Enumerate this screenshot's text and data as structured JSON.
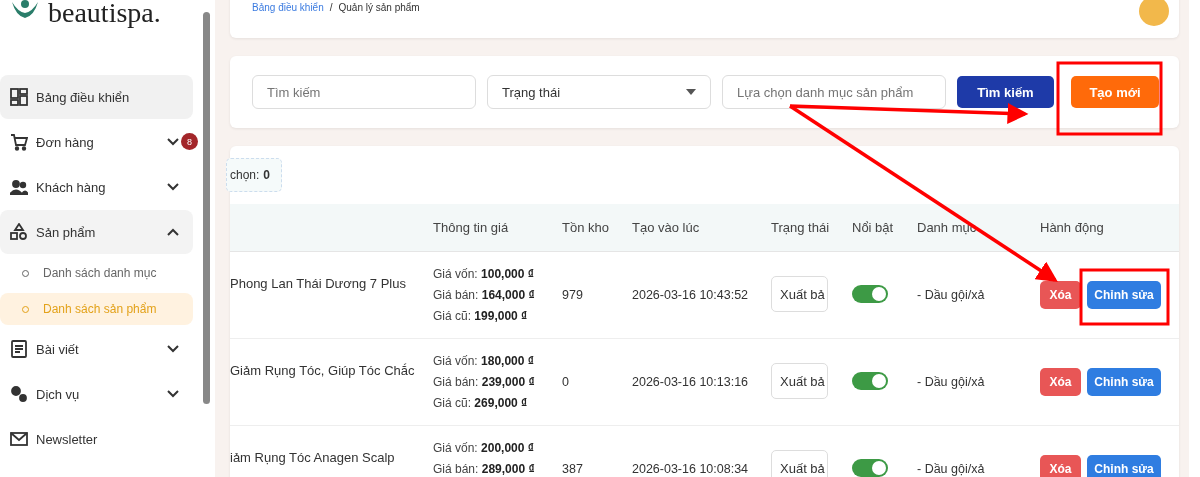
{
  "logo": {
    "text": "beautispa."
  },
  "breadcrumb": [
    {
      "label": "Bảng điều khiển",
      "link": true
    },
    {
      "label": "/",
      "link": false
    },
    {
      "label": "Quản lý sản phẩm",
      "link": false
    }
  ],
  "sidebar": {
    "items": [
      {
        "label": "Bảng điều khiển",
        "selected": false,
        "hovered": true
      },
      {
        "label": "Đơn hàng",
        "expanded": false,
        "badge": "8",
        "selected": false
      },
      {
        "label": "Khách hàng",
        "expanded": false,
        "selected": false
      },
      {
        "label": "Sản phẩm",
        "expanded": true,
        "selected": false,
        "children": [
          {
            "label": "Danh sách danh mục",
            "selected": false
          },
          {
            "label": "Danh sách sản phẩm",
            "selected": true
          }
        ]
      },
      {
        "label": "Bài viết",
        "expanded": false,
        "selected": false
      },
      {
        "label": "Dịch vụ",
        "expanded": false,
        "selected": false
      },
      {
        "label": "Newsletter",
        "selected": false
      }
    ]
  },
  "filters": {
    "search": {
      "placeholder": "Tìm kiếm"
    },
    "status": {
      "value": "Trạng thái"
    },
    "category": {
      "placeholder": "Lựa chọn danh mục sản phẩm"
    },
    "search_button": "Tìm kiếm",
    "create_button": "Tạo mới"
  },
  "selection": {
    "label": "chọn:",
    "count": "0"
  },
  "table": {
    "columns": [
      "Thông tin giá",
      "Tồn kho",
      "Tạo vào lúc",
      "Trạng thái",
      "Nổi bật",
      "Danh mục",
      "Hành động"
    ],
    "rows": [
      {
        "name": "Phong Lan Thái Dương 7 Plus",
        "prices": [
          {
            "label": "Giá vốn:",
            "value": "100,000 ₫"
          },
          {
            "label": "Giá bán:",
            "value": "164,000 ₫"
          },
          {
            "label": "Giá cũ:",
            "value": "199,000 ₫"
          }
        ],
        "stock": "979",
        "created": "2026-03-16 10:43:52",
        "status": "Xuất bả",
        "featured": true,
        "category": "- Dầu gội/xả",
        "delete": "Xóa",
        "edit": "Chỉnh sửa"
      },
      {
        "name": "Giảm Rụng Tóc, Giúp Tóc Chắc",
        "prices": [
          {
            "label": "Giá vốn:",
            "value": "180,000 ₫"
          },
          {
            "label": "Giá bán:",
            "value": "239,000 ₫"
          },
          {
            "label": "Giá cũ:",
            "value": "269,000 ₫"
          }
        ],
        "stock": "0",
        "created": "2026-03-16 10:13:16",
        "status": "Xuất bả",
        "featured": true,
        "category": "- Dầu gội/xả",
        "delete": "Xóa",
        "edit": "Chỉnh sửa"
      },
      {
        "name": "iảm Rụng Tóc Anagen Scalp",
        "prices": [
          {
            "label": "Giá vốn:",
            "value": "200,000 ₫"
          },
          {
            "label": "Giá bán:",
            "value": "289,000 ₫"
          }
        ],
        "stock": "387",
        "created": "2026-03-16 10:08:34",
        "status": "Xuất bả",
        "featured": true,
        "category": "- Dầu gội/xả",
        "delete": "Xóa",
        "edit": "Chỉnh sửa"
      }
    ]
  }
}
